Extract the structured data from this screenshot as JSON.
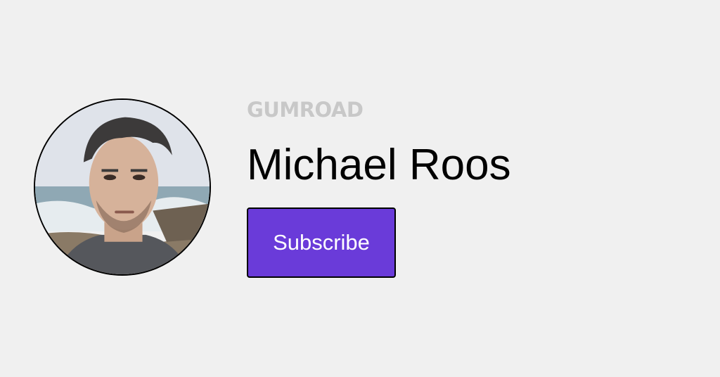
{
  "brand": {
    "logo_text": "GUMROAD"
  },
  "profile": {
    "name": "Michael Roos",
    "avatar": "profile-photo"
  },
  "actions": {
    "subscribe_label": "Subscribe"
  },
  "colors": {
    "background": "#f0f0f0",
    "button": "#6a3bd9",
    "logo": "#c8c8c8",
    "text": "#000000"
  }
}
